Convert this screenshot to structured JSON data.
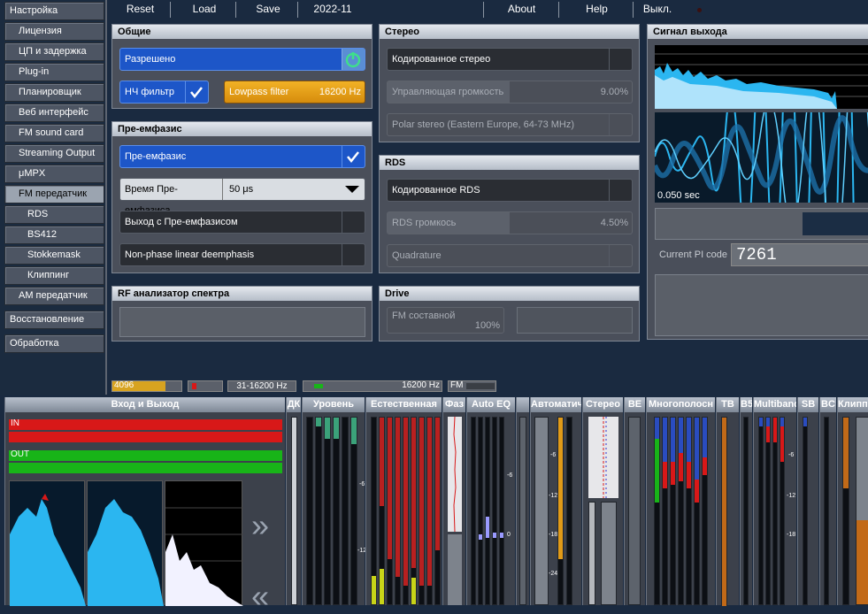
{
  "sidebar": {
    "items": [
      {
        "label": "Настройка"
      },
      {
        "label": "Лицензия"
      },
      {
        "label": "ЦП и задержка"
      },
      {
        "label": "Plug-in"
      },
      {
        "label": "Планировщик"
      },
      {
        "label": "Веб интерфейс"
      },
      {
        "label": "FM sound card"
      },
      {
        "label": "Streaming Output"
      },
      {
        "label": "μMPX"
      },
      {
        "label": "FM передатчик"
      },
      {
        "label": "RDS"
      },
      {
        "label": "BS412"
      },
      {
        "label": "Stokkemask"
      },
      {
        "label": "Клиппинг"
      },
      {
        "label": "AM передатчик"
      },
      {
        "label": "Восстановление"
      },
      {
        "label": "Обработка"
      }
    ]
  },
  "topbar": {
    "reset": "Reset",
    "load": "Load",
    "save": "Save",
    "version": "2022-11",
    "about": "About",
    "help": "Help",
    "power": "Выкл."
  },
  "general": {
    "title": "Общие",
    "enabled": "Разрешено",
    "lpf_label": "НЧ фильтр",
    "lpf_value_label": "Lowpass filter",
    "lpf_value": "16200 Hz"
  },
  "preemph": {
    "title": "Пре-емфазис",
    "toggle": "Пре-емфазис",
    "time_label": "Время Пре-емфазиса",
    "time_value": "50 μs",
    "output": "Выход с Пре-емфазисом",
    "nonphase": "Non-phase linear deemphasis"
  },
  "rf": {
    "title": "RF анализатор спектра"
  },
  "stereo": {
    "title": "Стерео",
    "coded": "Кодированное стерео",
    "pilot_label": "Управляющая громкость",
    "pilot_value": "9.00%",
    "pilot_level": 0.09,
    "polar": "Polar stereo (Eastern Europe, 64-73 MHz)"
  },
  "rds": {
    "title": "RDS",
    "coded": "Кодированное RDS",
    "vol_label": "RDS громкось",
    "vol_value": "4.50%",
    "vol_level": 0.045,
    "quadrature": "Quadrature"
  },
  "drive": {
    "title": "Drive",
    "composite_label": "FM составной",
    "composite_value": "100%"
  },
  "output": {
    "title": "Сигнал выхода",
    "time": "0.050 sec",
    "pi_label": "Current PI code",
    "pi_value": "7261"
  },
  "status": {
    "cpu": "4096",
    "band": "31-16200 Hz",
    "freq": "16200 Hz",
    "mode": "FM"
  },
  "bottom": {
    "io_title": "Вход и Выход",
    "in_label": "IN",
    "out_label": "OUT",
    "panels": [
      "ДК",
      "Уровень",
      "Естественная",
      "Фаз",
      "Auto EQ",
      "Автоматич",
      "Стерео",
      "BE",
      "Многополосн",
      "ТВ",
      "B5",
      "Multiband",
      "SB",
      "BC",
      "Клиппи"
    ],
    "ticks": [
      "-6",
      "-12",
      "-18",
      "-24",
      "0"
    ]
  },
  "colors": {
    "accent_blue": "#1d56c8",
    "orange": "#e8a21a",
    "meter_red": "#d81818",
    "meter_green": "#18b418",
    "scope_cyan": "#2bb6f0"
  }
}
